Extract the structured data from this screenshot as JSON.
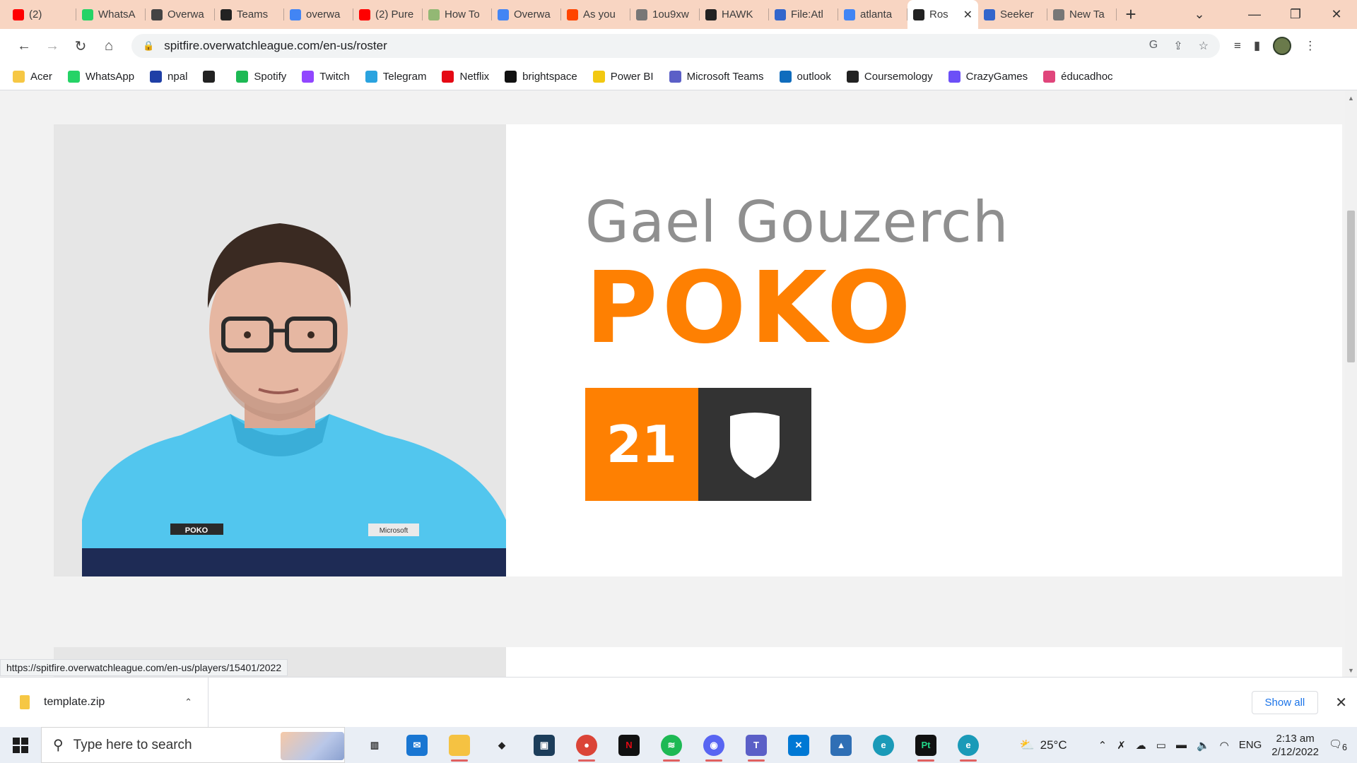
{
  "browser": {
    "tabs": [
      {
        "title": "(2)",
        "favicon": "youtube-icon",
        "color": "#ff0000"
      },
      {
        "title": "WhatsA",
        "favicon": "whatsapp-icon",
        "color": "#25d366"
      },
      {
        "title": "Overwa",
        "favicon": "overwatch-icon",
        "color": "#444444"
      },
      {
        "title": "Teams",
        "favicon": "team-logo-icon",
        "color": "#222222"
      },
      {
        "title": "overwa",
        "favicon": "google-icon",
        "color": "#4285f4"
      },
      {
        "title": "(2) Pure",
        "favicon": "youtube-icon",
        "color": "#ff0000"
      },
      {
        "title": "How To",
        "favicon": "wikihow-icon",
        "color": "#93b874"
      },
      {
        "title": "Overwa",
        "favicon": "google-icon",
        "color": "#4285f4"
      },
      {
        "title": "As you",
        "favicon": "reddit-icon",
        "color": "#ff4500"
      },
      {
        "title": "1ou9xw",
        "favicon": "globe-icon",
        "color": "#777777"
      },
      {
        "title": "HAWK",
        "favicon": "team-logo-icon",
        "color": "#222222"
      },
      {
        "title": "File:Atl",
        "favicon": "wiki-icon",
        "color": "#3366cc"
      },
      {
        "title": "atlanta",
        "favicon": "google-icon",
        "color": "#4285f4"
      },
      {
        "title": "Ros",
        "favicon": "team-logo-icon",
        "color": "#222222",
        "active": true
      },
      {
        "title": "Seeker",
        "favicon": "wiki-icon",
        "color": "#3366cc"
      },
      {
        "title": "New Ta",
        "favicon": "chrome-icon",
        "color": "#777777"
      }
    ],
    "url": "spitfire.overwatchleague.com/en-us/roster",
    "bookmarks": [
      {
        "label": "Acer",
        "icon": "folder-icon",
        "color": "#f6c744"
      },
      {
        "label": "WhatsApp",
        "icon": "whatsapp-icon",
        "color": "#25d366"
      },
      {
        "label": "npal",
        "icon": "npal-icon",
        "color": "#1f3fa6"
      },
      {
        "label": "",
        "icon": "globe-icon",
        "color": "#222222"
      },
      {
        "label": "Spotify",
        "icon": "spotify-icon",
        "color": "#1db954"
      },
      {
        "label": "Twitch",
        "icon": "twitch-icon",
        "color": "#9146ff"
      },
      {
        "label": "Telegram",
        "icon": "telegram-icon",
        "color": "#2aa3df"
      },
      {
        "label": "Netflix",
        "icon": "netflix-icon",
        "color": "#e50914"
      },
      {
        "label": "brightspace",
        "icon": "np-icon",
        "color": "#111111"
      },
      {
        "label": "Power BI",
        "icon": "powerbi-icon",
        "color": "#f2c811"
      },
      {
        "label": "Microsoft Teams",
        "icon": "teams-icon",
        "color": "#5b5fc7"
      },
      {
        "label": "outlook",
        "icon": "outlook-icon",
        "color": "#0f6cbd"
      },
      {
        "label": "Coursemology",
        "icon": "coursemology-icon",
        "color": "#222222"
      },
      {
        "label": "CrazyGames",
        "icon": "crazygames-icon",
        "color": "#6c4ff7"
      },
      {
        "label": "éducadhoc",
        "icon": "educadhoc-icon",
        "color": "#e0457b"
      }
    ],
    "status_url": "https://spitfire.overwatchleague.com/en-us/players/15401/2022"
  },
  "player": {
    "real_name": "Gael Gouzerch",
    "handle": "POKO",
    "number": "21",
    "role_icon": "shield-role-icon",
    "accent_color": "#fe8002",
    "jersey_name": "POKO",
    "jersey_sponsor": "Microsoft"
  },
  "downloads": {
    "file": "template.zip",
    "show_all": "Show all"
  },
  "taskbar": {
    "search_placeholder": "Type here to search",
    "weather": "25°C",
    "language": "ENG",
    "time": "2:13 am",
    "date": "2/12/2022",
    "notifications": "6"
  }
}
